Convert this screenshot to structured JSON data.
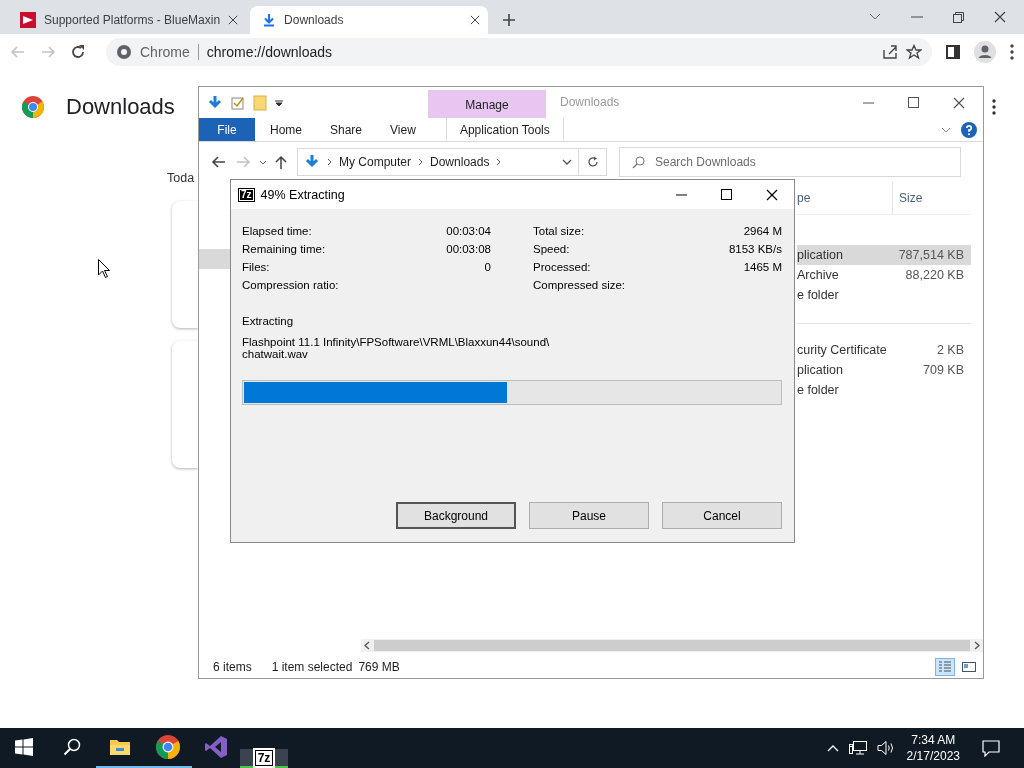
{
  "browser": {
    "tabs": [
      {
        "title": "Supported Platforms - BlueMaxin",
        "kind": "site",
        "selected": false
      },
      {
        "title": "Downloads",
        "kind": "downloads",
        "selected": true
      }
    ],
    "nav_buttons": [
      {
        "kind": "back",
        "disabled": true
      },
      {
        "kind": "forward",
        "disabled": true
      },
      {
        "kind": "reload",
        "disabled": false
      }
    ],
    "omnibox": {
      "site_label": "Chrome",
      "url": "chrome://downloads"
    }
  },
  "page": {
    "title": "Downloads",
    "section_label": "Toda"
  },
  "explorer": {
    "title": "Downloads",
    "context_tab": "Manage",
    "ribbon_tabs": [
      {
        "label": "File",
        "kind": "file"
      },
      {
        "label": "Home",
        "kind": "plain"
      },
      {
        "label": "Share",
        "kind": "plain"
      },
      {
        "label": "View",
        "kind": "plain"
      },
      {
        "label": "Application Tools",
        "kind": "context"
      }
    ],
    "nav_buttons": [
      {
        "kind": "back",
        "disabled": false
      },
      {
        "kind": "forward",
        "disabled": true
      }
    ],
    "breadcrumb": [
      "My Computer",
      "Downloads"
    ],
    "search": {
      "placeholder": "Search Downloads"
    },
    "columns": [
      "pe",
      "Size"
    ],
    "groups": [
      {
        "rows": [
          {
            "type": "plication",
            "size": "787,514 KB",
            "selected": true
          },
          {
            "type": "Archive",
            "size": "88,220 KB",
            "selected": false
          },
          {
            "type": "e folder",
            "selected": false
          }
        ]
      },
      {
        "rows": [
          {
            "type": "curity Certificate",
            "size": "2 KB",
            "selected": false
          },
          {
            "type": "plication",
            "size": "709 KB",
            "selected": false
          },
          {
            "type": "e folder",
            "selected": false
          }
        ]
      }
    ],
    "status": {
      "item_count": "6 items",
      "selection": "1 item selected",
      "selection_size": "769 MB"
    },
    "view_buttons": [
      {
        "kind": "details",
        "selected": true
      },
      {
        "kind": "tiles",
        "selected": false
      }
    ]
  },
  "extract_dialog": {
    "icon_text": "7z",
    "title": "49% Extracting",
    "stats_left": [
      {
        "label": "Elapsed time:",
        "value": "00:03:04"
      },
      {
        "label": "Remaining time:",
        "value": "00:03:08"
      },
      {
        "label": "Files:",
        "value": "0"
      },
      {
        "label": "Compression ratio:"
      }
    ],
    "stats_right": [
      {
        "label": "Total size:",
        "value": "2964 M"
      },
      {
        "label": "Speed:",
        "value": "8153 KB/s"
      },
      {
        "label": "Processed:",
        "value": "1465 M"
      },
      {
        "label": "Compressed size:"
      }
    ],
    "action": "Extracting",
    "path_lines": [
      "Flashpoint 11.1 Infinity\\FPSoftware\\VRML\\Blaxxun44\\sound\\",
      "chatwait.wav"
    ],
    "level": 0.49,
    "buttons": [
      {
        "label": "Background",
        "focused": true
      },
      {
        "label": "Pause",
        "focused": false
      },
      {
        "label": "Cancel",
        "focused": false
      }
    ]
  },
  "taskbar": {
    "apps": [
      {
        "kind": "explorer",
        "running": true,
        "active": false
      },
      {
        "kind": "chrome",
        "running": true,
        "active": false
      },
      {
        "kind": "studio",
        "running": false,
        "active": false
      },
      {
        "kind": "sevenzip",
        "icon_text": "7z",
        "running": true,
        "active": true
      }
    ],
    "clock": {
      "time": "7:34 AM",
      "date": "2/17/2023"
    }
  }
}
